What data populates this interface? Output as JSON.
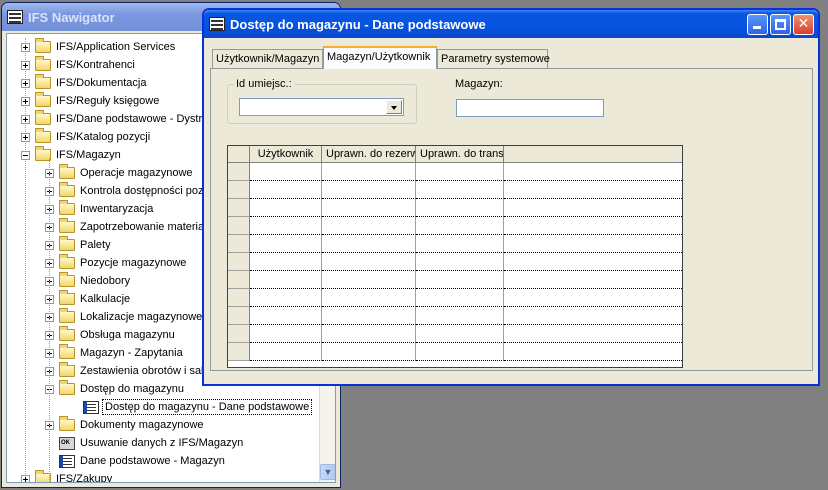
{
  "navigator": {
    "title": "IFS Nawigator",
    "items": [
      {
        "label": "IFS/Application Services",
        "icon": "folder-icon",
        "expander": "plus"
      },
      {
        "label": "IFS/Kontrahenci",
        "icon": "folder-icon",
        "expander": "plus"
      },
      {
        "label": "IFS/Dokumentacja",
        "icon": "folder-icon",
        "expander": "plus"
      },
      {
        "label": "IFS/Reguły księgowe",
        "icon": "folder-icon",
        "expander": "plus"
      },
      {
        "label": "IFS/Dane podstawowe - Dystrybucja",
        "icon": "folder-icon",
        "expander": "plus"
      },
      {
        "label": "IFS/Katalog pozycji",
        "icon": "folder-icon",
        "expander": "plus"
      },
      {
        "label": "IFS/Magazyn",
        "icon": "folder-icon",
        "expander": "minus"
      },
      {
        "label": "Operacje magazynowe",
        "icon": "folder-icon",
        "expander": "plus"
      },
      {
        "label": "Kontrola dostępności pozycji",
        "icon": "folder-icon",
        "expander": "plus"
      },
      {
        "label": "Inwentaryzacja",
        "icon": "folder-icon",
        "expander": "plus"
      },
      {
        "label": "Zapotrzebowanie materiałowe",
        "icon": "folder-icon",
        "expander": "plus"
      },
      {
        "label": "Palety",
        "icon": "folder-icon",
        "expander": "plus"
      },
      {
        "label": "Pozycje magazynowe",
        "icon": "folder-icon",
        "expander": "plus"
      },
      {
        "label": "Niedobory",
        "icon": "folder-icon",
        "expander": "plus"
      },
      {
        "label": "Kalkulacje",
        "icon": "folder-icon",
        "expander": "plus"
      },
      {
        "label": "Lokalizacje magazynowe",
        "icon": "folder-icon",
        "expander": "plus"
      },
      {
        "label": "Obsługa magazynu",
        "icon": "folder-icon",
        "expander": "plus"
      },
      {
        "label": "Magazyn - Zapytania",
        "icon": "folder-icon",
        "expander": "plus"
      },
      {
        "label": "Zestawienia obrotów i sald",
        "icon": "folder-icon",
        "expander": "plus"
      },
      {
        "label": "Dostęp do magazynu",
        "icon": "folder-icon",
        "expander": "minus"
      },
      {
        "label": "Dostęp do magazynu - Dane podstawowe",
        "icon": "form-icon",
        "expander": "none",
        "selected": true
      },
      {
        "label": "Dokumenty magazynowe",
        "icon": "folder-icon",
        "expander": "plus"
      },
      {
        "label": "Usuwanie danych z IFS/Magazyn",
        "icon": "delete-data-icon",
        "expander": "none"
      },
      {
        "label": "Dane podstawowe - Magazyn",
        "icon": "form-icon",
        "expander": "none"
      },
      {
        "label": "IFS/Zakupy",
        "icon": "folder-icon",
        "expander": "plus"
      }
    ]
  },
  "dialog": {
    "title": "Dostęp do magazynu - Dane podstawowe",
    "tabs": [
      "Użytkownik/Magazyn",
      "Magazyn/Użytkownik",
      "Parametry systemowe"
    ],
    "active_tab": 1,
    "id_label": "Id umiejsc.:",
    "id_value": "",
    "magazyn_label": "Magazyn:",
    "magazyn_value": "",
    "grid": {
      "columns": [
        "Użytkownik",
        "Uprawn. do rezerwacji",
        "Uprawn. do transakcji"
      ],
      "rows": [
        [
          "",
          "",
          ""
        ],
        [
          "",
          "",
          ""
        ],
        [
          "",
          "",
          ""
        ],
        [
          "",
          "",
          ""
        ],
        [
          "",
          "",
          ""
        ],
        [
          "",
          "",
          ""
        ],
        [
          "",
          "",
          ""
        ],
        [
          "",
          "",
          ""
        ],
        [
          "",
          "",
          ""
        ],
        [
          "",
          "",
          ""
        ],
        [
          "",
          "",
          ""
        ]
      ]
    }
  },
  "colors": {
    "desktop": "#808080",
    "title_active": "#0553e0",
    "title_inactive": "#7a96df",
    "window_bg": "#ece9d8",
    "tab_highlight": "#f3b12e"
  }
}
